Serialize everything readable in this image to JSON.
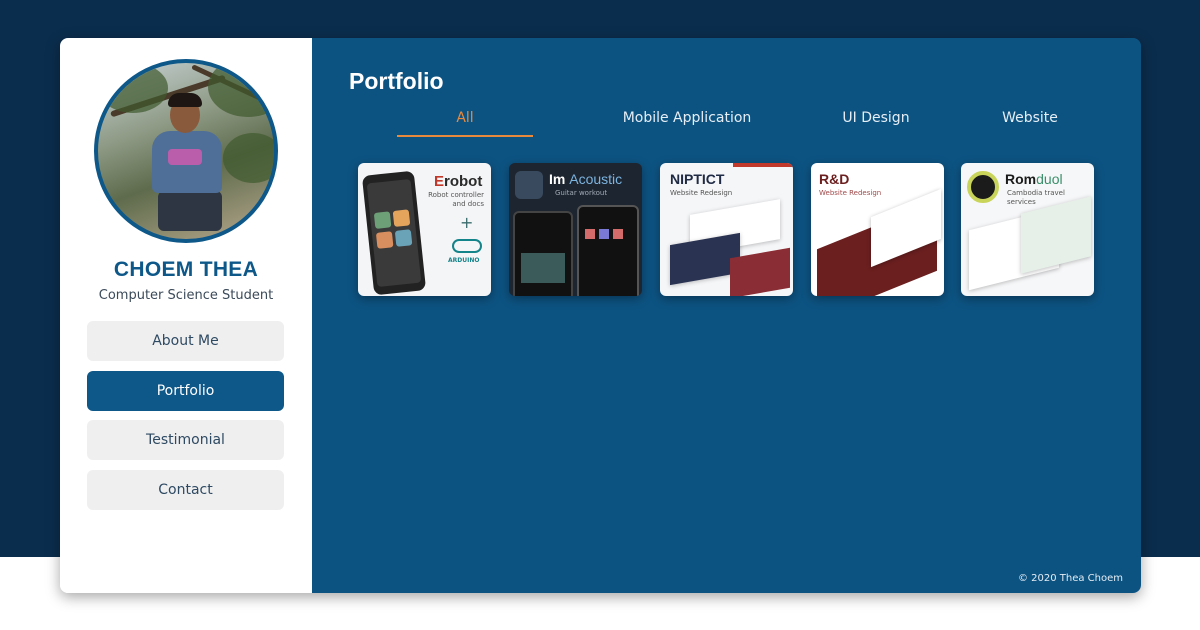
{
  "profile": {
    "name": "CHOEM THEA",
    "role": "Computer Science Student"
  },
  "nav": {
    "items": [
      "About Me",
      "Portfolio",
      "Testimonial",
      "Contact"
    ],
    "active": "Portfolio"
  },
  "portfolio": {
    "title": "Portfolio",
    "tabs": [
      "All",
      "Mobile Application",
      "UI Design",
      "Website"
    ],
    "active_tab": "All",
    "projects": [
      {
        "title_lead": "E",
        "title_rest": "robot",
        "subtitle": "Robot controller and docs",
        "badge": "ARDUINO",
        "plus": "+"
      },
      {
        "title_lead": "Im ",
        "title_rest": "Acoustic",
        "subtitle": "Guitar workout"
      },
      {
        "title_lead": "",
        "title_rest": "NIPTICT",
        "subtitle": "Website Redesign"
      },
      {
        "title_lead": "",
        "title_rest": "R&D",
        "subtitle": "Website Redesign"
      },
      {
        "title_lead": "Rom",
        "title_rest": "duol",
        "subtitle": "Cambodia travel services"
      }
    ]
  },
  "footer": {
    "copyright": "© 2020 Thea Choem"
  },
  "colors": {
    "page_bg": "#0b2d4d",
    "primary": "#0d5789",
    "main_bg": "#0d5382",
    "accent": "#e8893c",
    "nav_bg": "#efefef"
  }
}
